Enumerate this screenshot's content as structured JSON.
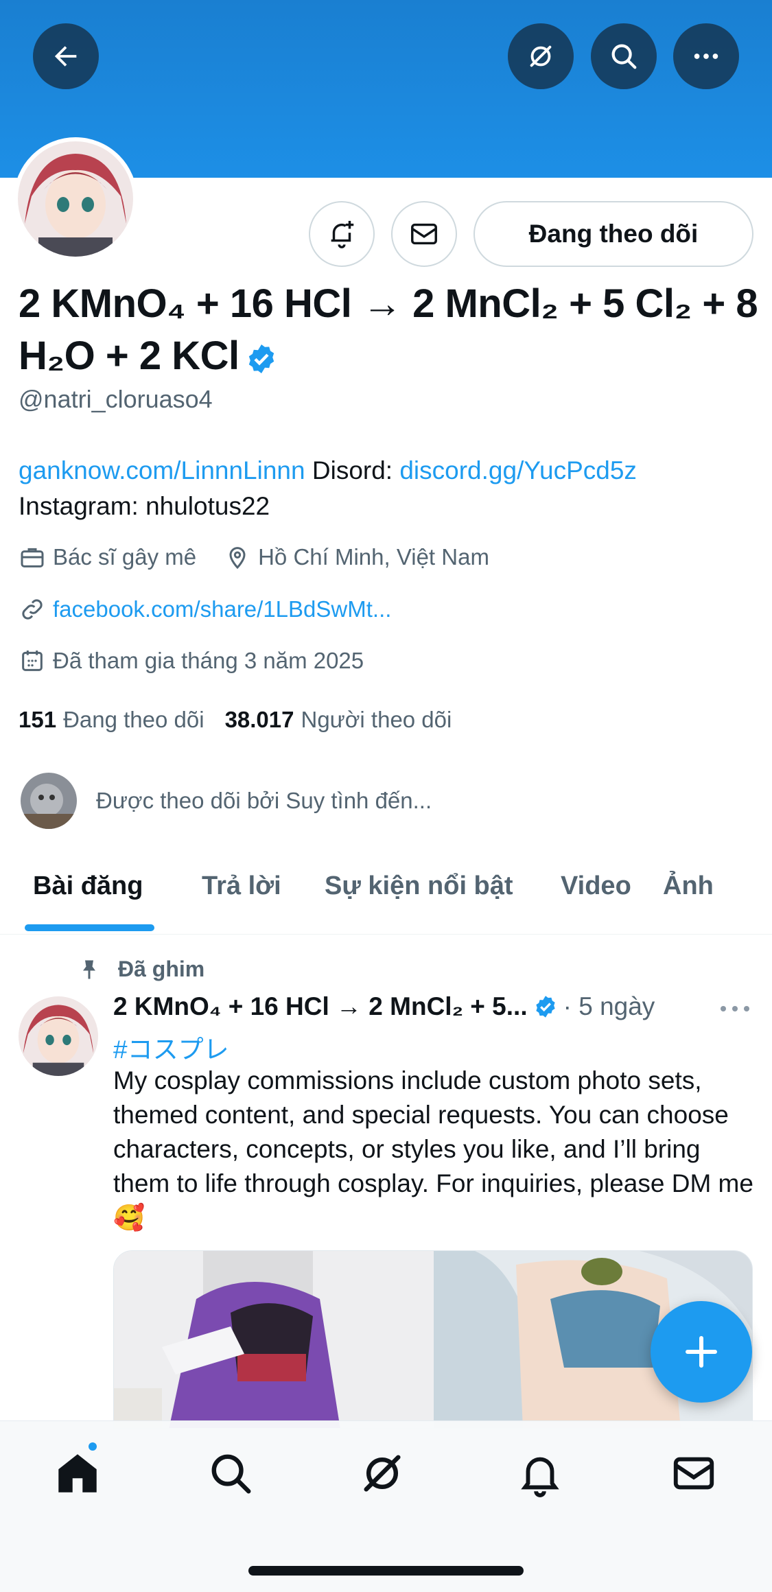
{
  "header": {
    "back_icon": "arrow-left-icon",
    "actions": [
      "grok-icon",
      "search-icon",
      "more-icon"
    ]
  },
  "profile": {
    "display_name": "2 KMnO₄ + 16 HCl → 2 MnCl₂ + 5 Cl₂ + 8 H₂O + 2 KCl",
    "handle": "@natri_cloruaso4",
    "follow_label": "Đang theo dõi",
    "bio": {
      "link1": "ganknow.com/LinnnLinnn",
      "disord_label": " Disord: ",
      "link2": "discord.gg/YucPcd5z",
      "instagram": "Instagram: nhulotus22"
    },
    "occupation": "Bác sĩ gây mê",
    "location": "Hồ Chí Minh, Việt Nam",
    "website": "facebook.com/share/1LBdSwMt...",
    "joined": "Đã tham gia tháng 3 năm 2025",
    "following_count": "151",
    "following_label": "Đang theo dõi",
    "followers_count": "38.017",
    "followers_label": "Người theo dõi",
    "followed_by": "Được theo dõi bởi Suy tình đến..."
  },
  "tabs": [
    "Bài đăng",
    "Trả lời",
    "Sự kiện nổi bật",
    "Video",
    "Ảnh"
  ],
  "post": {
    "pinned_label": "Đã ghim",
    "name": "2 KMnO₄ + 16 HCl → 2 MnCl₂ + 5...",
    "time": "· 5 ngày",
    "hashtag": "#コスプレ",
    "text": "My cosplay commissions include custom photo sets, themed content, and special requests. You can choose characters, concepts, or styles you like, and I’ll bring them to life through cosplay. For inquiries, please DM me 🥰"
  },
  "colors": {
    "accent": "#1d9bf0",
    "banner": "#1d8fe6",
    "muted": "#536471"
  },
  "nav": [
    "home-icon",
    "search-icon",
    "grok-icon",
    "bell-icon",
    "mail-icon"
  ]
}
